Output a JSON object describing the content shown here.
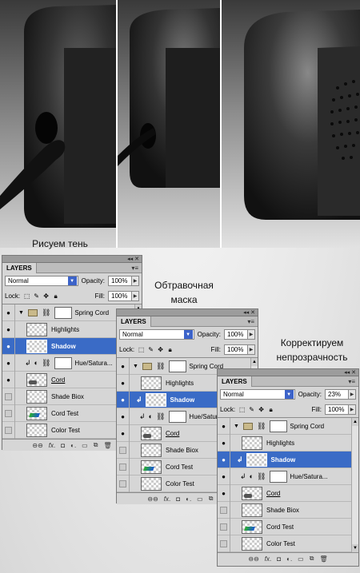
{
  "captions": {
    "step1": "Рисуем тень",
    "step2_line1": "Обтравочная",
    "step2_line2": "маска",
    "step3_line1": "Корректируем",
    "step3_line2": "непрозрачность"
  },
  "panels": [
    {
      "title": "LAYERS",
      "blend_mode": "Normal",
      "opacity_label": "Opacity:",
      "opacity": "100%",
      "lock_label": "Lock:",
      "fill_label": "Fill:",
      "fill": "100%",
      "layers": [
        {
          "name": "Spring Cord",
          "type": "group",
          "visible": true
        },
        {
          "name": "Highlights",
          "type": "layer",
          "visible": true
        },
        {
          "name": "Shadow",
          "type": "layer",
          "visible": true,
          "selected": true
        },
        {
          "name": "Hue/Satura...",
          "type": "adjustment",
          "visible": true
        },
        {
          "name": "Cord",
          "type": "layer",
          "visible": true,
          "underline": true
        },
        {
          "name": "Shade Biox",
          "type": "layer",
          "visible": false
        },
        {
          "name": "Cord Test",
          "type": "layer",
          "visible": false
        },
        {
          "name": "Color Test",
          "type": "layer",
          "visible": false
        }
      ]
    },
    {
      "title": "LAYERS",
      "blend_mode": "Normal",
      "opacity_label": "Opacity:",
      "opacity": "100%",
      "lock_label": "Lock:",
      "fill_label": "Fill:",
      "fill": "100%",
      "layers": [
        {
          "name": "Spring Cord",
          "type": "group",
          "visible": true
        },
        {
          "name": "Highlights",
          "type": "layer",
          "visible": true
        },
        {
          "name": "Shadow",
          "type": "layer",
          "visible": true,
          "selected": true,
          "clipped": true
        },
        {
          "name": "Hue/Satura...",
          "type": "adjustment",
          "visible": true
        },
        {
          "name": "Cord",
          "type": "layer",
          "visible": true,
          "underline": true
        },
        {
          "name": "Shade Biox",
          "type": "layer",
          "visible": false
        },
        {
          "name": "Cord Test",
          "type": "layer",
          "visible": false
        },
        {
          "name": "Color Test",
          "type": "layer",
          "visible": false
        }
      ]
    },
    {
      "title": "LAYERS",
      "blend_mode": "Normal",
      "opacity_label": "Opacity:",
      "opacity": "23%",
      "lock_label": "Lock:",
      "fill_label": "Fill:",
      "fill": "100%",
      "layers": [
        {
          "name": "Spring Cord",
          "type": "group",
          "visible": true
        },
        {
          "name": "Highlights",
          "type": "layer",
          "visible": true
        },
        {
          "name": "Shadow",
          "type": "layer",
          "visible": true,
          "selected": true,
          "clipped": true
        },
        {
          "name": "Hue/Satura...",
          "type": "adjustment",
          "visible": true
        },
        {
          "name": "Cord",
          "type": "layer",
          "visible": true,
          "underline": true
        },
        {
          "name": "Shade Biox",
          "type": "layer",
          "visible": false
        },
        {
          "name": "Cord Test",
          "type": "layer",
          "visible": false
        },
        {
          "name": "Color Test",
          "type": "layer",
          "visible": false
        }
      ]
    }
  ],
  "colors": {
    "selection": "#3a6bc6",
    "panel_bg": "#d6d6d6",
    "device_dark": "#2a2a2a"
  }
}
